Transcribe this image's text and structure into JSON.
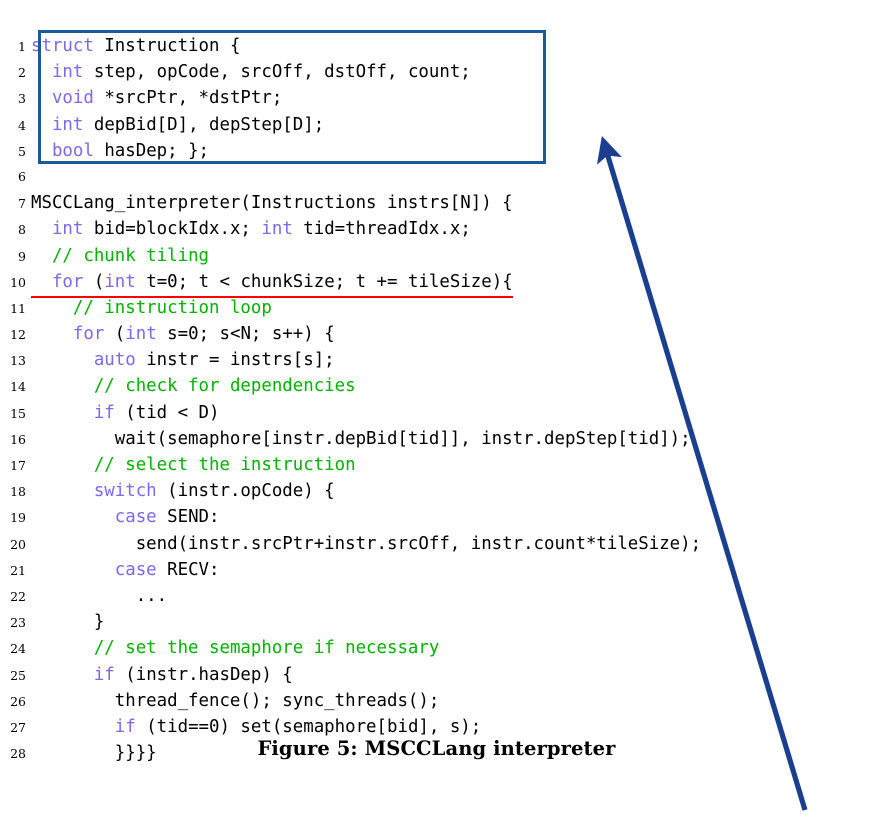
{
  "figure": {
    "caption": "Figure 5: MSCCLang interpreter",
    "box_color": "#1a5a96",
    "arrow_color": "#1a3f8f",
    "underline_color": "#ff0000",
    "keyword_color": "#7b68ee",
    "comment_color": "#00b200",
    "text_color": "#000000",
    "background_color": "#ffffff"
  },
  "code": {
    "language": "C++",
    "line_count": 28,
    "lines": [
      {
        "n": "1",
        "indent": 0,
        "tokens": [
          {
            "t": "struct",
            "c": "kw"
          },
          {
            "t": " Instruction {",
            "c": "plain"
          }
        ]
      },
      {
        "n": "2",
        "indent": 0,
        "tokens": [
          {
            "t": "  ",
            "c": "plain"
          },
          {
            "t": "int",
            "c": "kw"
          },
          {
            "t": " step, opCode, srcOff, dstOff, count;",
            "c": "plain"
          }
        ]
      },
      {
        "n": "3",
        "indent": 0,
        "tokens": [
          {
            "t": "  ",
            "c": "plain"
          },
          {
            "t": "void",
            "c": "kw"
          },
          {
            "t": " *srcPtr, *dstPtr;",
            "c": "plain"
          }
        ]
      },
      {
        "n": "4",
        "indent": 0,
        "tokens": [
          {
            "t": "  ",
            "c": "plain"
          },
          {
            "t": "int",
            "c": "kw"
          },
          {
            "t": " depBid[D], depStep[D];",
            "c": "plain"
          }
        ]
      },
      {
        "n": "5",
        "indent": 0,
        "tokens": [
          {
            "t": "  ",
            "c": "plain"
          },
          {
            "t": "bool",
            "c": "kw"
          },
          {
            "t": " hasDep; };",
            "c": "plain"
          }
        ]
      },
      {
        "n": "6",
        "indent": 0,
        "tokens": [
          {
            "t": "",
            "c": "plain"
          }
        ]
      },
      {
        "n": "7",
        "indent": 0,
        "tokens": [
          {
            "t": "MSCCLang_interpreter(Instructions instrs[N]) {",
            "c": "plain"
          }
        ]
      },
      {
        "n": "8",
        "indent": 0,
        "tokens": [
          {
            "t": "  ",
            "c": "plain"
          },
          {
            "t": "int",
            "c": "kw"
          },
          {
            "t": " bid=blockIdx.x; ",
            "c": "plain"
          },
          {
            "t": "int",
            "c": "kw"
          },
          {
            "t": " tid=threadIdx.x;",
            "c": "plain"
          }
        ]
      },
      {
        "n": "9",
        "indent": 0,
        "tokens": [
          {
            "t": "  ",
            "c": "plain"
          },
          {
            "t": "// chunk tiling",
            "c": "cmt"
          }
        ]
      },
      {
        "n": "10",
        "indent": 0,
        "underline": true,
        "tokens": [
          {
            "t": "  ",
            "c": "plain"
          },
          {
            "t": "for",
            "c": "kw"
          },
          {
            "t": " (",
            "c": "plain"
          },
          {
            "t": "int",
            "c": "kw"
          },
          {
            "t": " t=0; t < chunkSize; t += tileSize){",
            "c": "plain"
          }
        ]
      },
      {
        "n": "11",
        "indent": 0,
        "tokens": [
          {
            "t": "    ",
            "c": "plain"
          },
          {
            "t": "// instruction loop",
            "c": "cmt"
          }
        ]
      },
      {
        "n": "12",
        "indent": 0,
        "tokens": [
          {
            "t": "    ",
            "c": "plain"
          },
          {
            "t": "for",
            "c": "kw"
          },
          {
            "t": " (",
            "c": "plain"
          },
          {
            "t": "int",
            "c": "kw"
          },
          {
            "t": " s=0; s<N; s++) {",
            "c": "plain"
          }
        ]
      },
      {
        "n": "13",
        "indent": 0,
        "tokens": [
          {
            "t": "      ",
            "c": "plain"
          },
          {
            "t": "auto",
            "c": "kw"
          },
          {
            "t": " instr = instrs[s];",
            "c": "plain"
          }
        ]
      },
      {
        "n": "14",
        "indent": 0,
        "tokens": [
          {
            "t": "      ",
            "c": "plain"
          },
          {
            "t": "// check for dependencies",
            "c": "cmt"
          }
        ]
      },
      {
        "n": "15",
        "indent": 0,
        "tokens": [
          {
            "t": "      ",
            "c": "plain"
          },
          {
            "t": "if",
            "c": "kw"
          },
          {
            "t": " (tid < D)",
            "c": "plain"
          }
        ]
      },
      {
        "n": "16",
        "indent": 0,
        "tokens": [
          {
            "t": "        wait(semaphore[instr.depBid[tid]], instr.depStep[tid]);",
            "c": "plain"
          }
        ]
      },
      {
        "n": "17",
        "indent": 0,
        "tokens": [
          {
            "t": "      ",
            "c": "plain"
          },
          {
            "t": "// select the instruction",
            "c": "cmt"
          }
        ]
      },
      {
        "n": "18",
        "indent": 0,
        "tokens": [
          {
            "t": "      ",
            "c": "plain"
          },
          {
            "t": "switch",
            "c": "kw"
          },
          {
            "t": " (instr.opCode) {",
            "c": "plain"
          }
        ]
      },
      {
        "n": "19",
        "indent": 0,
        "tokens": [
          {
            "t": "        ",
            "c": "plain"
          },
          {
            "t": "case",
            "c": "kw"
          },
          {
            "t": " SEND:",
            "c": "plain"
          }
        ]
      },
      {
        "n": "20",
        "indent": 0,
        "tokens": [
          {
            "t": "          send(instr.srcPtr+instr.srcOff, instr.count*tileSize);",
            "c": "plain"
          }
        ]
      },
      {
        "n": "21",
        "indent": 0,
        "tokens": [
          {
            "t": "        ",
            "c": "plain"
          },
          {
            "t": "case",
            "c": "kw"
          },
          {
            "t": " RECV:",
            "c": "plain"
          }
        ]
      },
      {
        "n": "22",
        "indent": 0,
        "tokens": [
          {
            "t": "          ...",
            "c": "plain"
          }
        ]
      },
      {
        "n": "23",
        "indent": 0,
        "tokens": [
          {
            "t": "      }",
            "c": "plain"
          }
        ]
      },
      {
        "n": "24",
        "indent": 0,
        "tokens": [
          {
            "t": "      ",
            "c": "plain"
          },
          {
            "t": "// set the semaphore if necessary",
            "c": "cmt"
          }
        ]
      },
      {
        "n": "25",
        "indent": 0,
        "tokens": [
          {
            "t": "      ",
            "c": "plain"
          },
          {
            "t": "if",
            "c": "kw"
          },
          {
            "t": " (instr.hasDep) {",
            "c": "plain"
          }
        ]
      },
      {
        "n": "26",
        "indent": 0,
        "tokens": [
          {
            "t": "        thread_fence(); sync_threads();",
            "c": "plain"
          }
        ]
      },
      {
        "n": "27",
        "indent": 0,
        "tokens": [
          {
            "t": "        ",
            "c": "plain"
          },
          {
            "t": "if",
            "c": "kw"
          },
          {
            "t": " (tid==0) set(semaphore[bid], s);",
            "c": "plain"
          }
        ]
      },
      {
        "n": "28",
        "indent": 0,
        "tokens": [
          {
            "t": "        }}}}",
            "c": "plain"
          }
        ]
      }
    ]
  }
}
